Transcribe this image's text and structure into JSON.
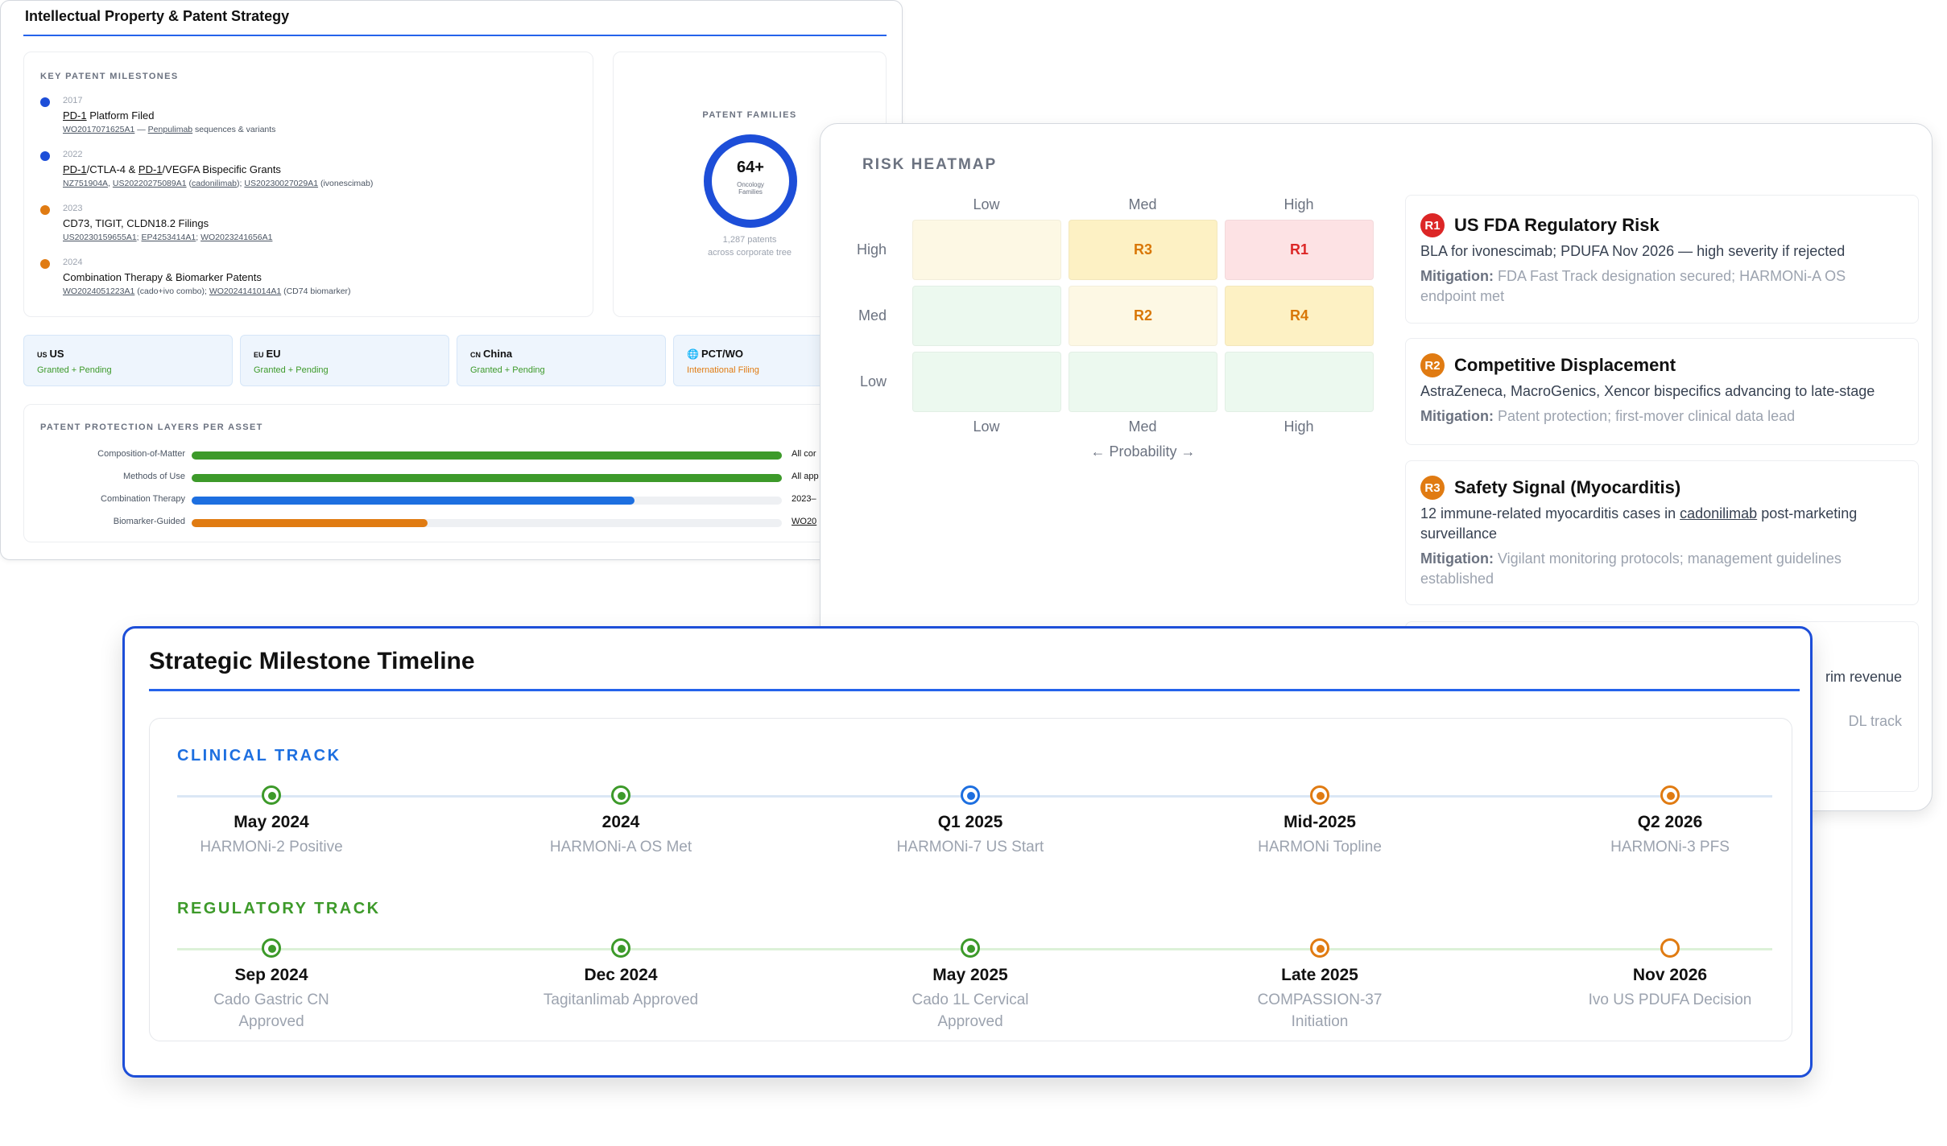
{
  "ip": {
    "title": "Intellectual Property & Patent Strategy",
    "milestones_label": "KEY PATENT MILESTONES",
    "milestones": [
      {
        "year": "2017",
        "head_prefix": "PD-1",
        "head_suffix": " Platform Filed",
        "refs_a": "WO2017071625A1",
        "refs_b": " — ",
        "refs_c": "Penpulimab",
        "refs_d": " sequences & variants",
        "dot_color": "#1d4ed8"
      },
      {
        "year": "2022",
        "head_a": "PD-1",
        "head_b": "/CTLA-4 & ",
        "head_c": "PD-1",
        "head_d": "/VEGFA Bispecific Grants",
        "refs_1": "NZ751904A",
        "refs_2": "US20220275089A1",
        "refs_3": "cadonilimab",
        "refs_4": "US20230027029A1",
        "refs_5": "(ivonescimab)",
        "dot_color": "#1d4ed8"
      },
      {
        "year": "2023",
        "head": "CD73, TIGIT, CLDN18.2 Filings",
        "refs_1": "US20230159655A1",
        "refs_2": "EP4253414A1",
        "refs_3": "WO2023241656A1",
        "dot_color": "#e07b12"
      },
      {
        "year": "2024",
        "head": "Combination Therapy & Biomarker Patents",
        "refs_1": "WO2024051223A1",
        "refs_2": "(cado+ivo combo);",
        "refs_3": "WO2024141014A1",
        "refs_4": "(CD74 biomarker)",
        "dot_color": "#e07b12"
      }
    ],
    "families": {
      "label": "PATENT FAMILIES",
      "value": "64+",
      "sub": "Oncology Families",
      "foot1": "1,287 patents",
      "foot2": "across corporate tree"
    },
    "jurisdictions": [
      {
        "code": "US",
        "name": "US",
        "status": "Granted + Pending",
        "status_color": "#3d9a2a"
      },
      {
        "code": "EU",
        "name": "EU",
        "status": "Granted + Pending",
        "status_color": "#3d9a2a"
      },
      {
        "code": "CN",
        "name": "China",
        "status": "Granted + Pending",
        "status_color": "#3d9a2a"
      },
      {
        "code": "🌐",
        "name": "PCT/WO",
        "status": "International Filing",
        "status_color": "#e07b12"
      }
    ],
    "layers_label": "PATENT PROTECTION LAYERS PER ASSET",
    "layers": [
      {
        "label": "Composition-of-Matter",
        "fill": 1.0,
        "color": "#3d9a2a",
        "note": "All cor"
      },
      {
        "label": "Methods of Use",
        "fill": 1.0,
        "color": "#3d9a2a",
        "note": "All app"
      },
      {
        "label": "Combination Therapy",
        "fill": 0.75,
        "color": "#1d6fe0",
        "note": "2023–"
      },
      {
        "label": "Biomarker-Guided",
        "fill": 0.4,
        "color": "#e07b12",
        "note": "WO20"
      }
    ]
  },
  "risk": {
    "title": "RISK HEATMAP",
    "col_labels_top": [
      "Low",
      "Med",
      "High"
    ],
    "col_labels_bottom": [
      "Low",
      "Med",
      "High"
    ],
    "row_labels": [
      "High",
      "Med",
      "Low"
    ],
    "x_axis_label": "← Probability →",
    "cells": [
      [
        {
          "label": "",
          "bg": "#fdf8e4",
          "fg": "#d97706"
        },
        {
          "label": "R3",
          "bg": "#fdf1c4",
          "fg": "#d97706"
        },
        {
          "label": "R1",
          "bg": "#fde2e4",
          "fg": "#dc2626"
        }
      ],
      [
        {
          "label": "",
          "bg": "#ecf9ef",
          "fg": "#111"
        },
        {
          "label": "R2",
          "bg": "#fdf8e4",
          "fg": "#d97706"
        },
        {
          "label": "R4",
          "bg": "#fdf1c4",
          "fg": "#d97706"
        }
      ],
      [
        {
          "label": "",
          "bg": "#ecf9ef",
          "fg": "#111"
        },
        {
          "label": "",
          "bg": "#ecf9ef",
          "fg": "#111"
        },
        {
          "label": "",
          "bg": "#ecf9ef",
          "fg": "#111"
        }
      ]
    ],
    "items": [
      {
        "badge": "R1",
        "badge_color": "#dc2626",
        "title": "US FDA Regulatory Risk",
        "body": "BLA for ivonescimab; PDUFA Nov 2026 — high severity if rejected",
        "mit_label": "Mitigation:",
        "mit": " FDA Fast Track designation secured; HARMONi-A OS endpoint met"
      },
      {
        "badge": "R2",
        "badge_color": "#e07b12",
        "title": "Competitive Displacement",
        "body": "AstraZeneca, MacroGenics, Xencor bispecifics advancing to late-stage",
        "mit_label": "Mitigation:",
        "mit": " Patent protection; first-mover clinical data lead"
      },
      {
        "badge": "R3",
        "badge_color": "#e07b12",
        "title": "Safety Signal (Myocarditis)",
        "body_a": "12 immune-related myocarditis cases in ",
        "body_b": "cadonilimab",
        "body_c": " post-marketing surveillance",
        "mit_label": "Mitigation:",
        "mit": " Vigilant monitoring protocols; management guidelines established"
      }
    ],
    "partial_1": "rim revenue",
    "partial_2": "DL track"
  },
  "timeline": {
    "title": "Strategic Milestone Timeline",
    "tracks": [
      {
        "label": "CLINICAL TRACK",
        "label_color": "#1d6fe0",
        "line_color": "#dbe7f5",
        "nodes": [
          {
            "date": "May 2024",
            "desc": "HARMONi-2 Positive",
            "color": "#3d9a2a",
            "style": "filled"
          },
          {
            "date": "2024",
            "desc": "HARMONi-A OS Met",
            "color": "#3d9a2a",
            "style": "filled"
          },
          {
            "date": "Q1 2025",
            "desc": "HARMONi-7 US Start",
            "color": "#1d6fe0",
            "style": "filled"
          },
          {
            "date": "Mid-2025",
            "desc": "HARMONi Topline",
            "color": "#e07b12",
            "style": "filled"
          },
          {
            "date": "Q2 2026",
            "desc": "HARMONi-3 PFS",
            "color": "#e07b12",
            "style": "filled"
          }
        ]
      },
      {
        "label": "REGULATORY TRACK",
        "label_color": "#3d9a2a",
        "line_color": "#dcf1d8",
        "nodes": [
          {
            "date": "Sep 2024",
            "desc": "Cado Gastric CN Approved",
            "color": "#3d9a2a",
            "style": "filled"
          },
          {
            "date": "Dec 2024",
            "desc": "Tagitanlimab Approved",
            "color": "#3d9a2a",
            "style": "filled"
          },
          {
            "date": "May 2025",
            "desc": "Cado 1L Cervical Approved",
            "color": "#3d9a2a",
            "style": "filled"
          },
          {
            "date": "Late 2025",
            "desc": "COMPASSION-37 Initiation",
            "color": "#e07b12",
            "style": "filled"
          },
          {
            "date": "Nov 2026",
            "desc": "Ivo US PDUFA Decision",
            "color": "#e07b12",
            "style": "hollow"
          }
        ]
      }
    ]
  }
}
